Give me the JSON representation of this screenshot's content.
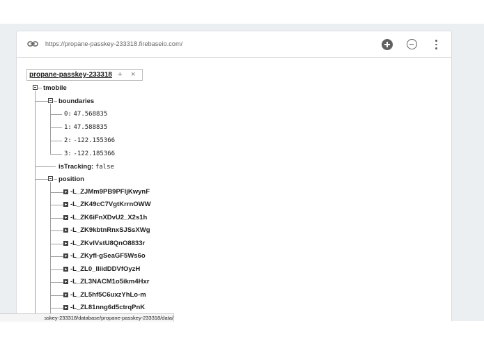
{
  "urlbar": {
    "url": "https://propane-passkey-233318.firebaseio.com/",
    "icons": {
      "link": "link-icon",
      "add": "add-circle-icon",
      "remove": "remove-circle-icon",
      "more": "more-vert-icon"
    }
  },
  "root": {
    "name": "propane-passkey-233318",
    "add_symbol": "+",
    "close_symbol": "×"
  },
  "tree": {
    "tmobile": {
      "label": "tmobile",
      "boundaries": {
        "label": "boundaries",
        "items": [
          {
            "key": "0:",
            "value": "47.568835"
          },
          {
            "key": "1:",
            "value": "47.588835"
          },
          {
            "key": "2:",
            "value": "-122.155366"
          },
          {
            "key": "3:",
            "value": "-122.185366"
          }
        ]
      },
      "isTracking": {
        "key": "isTracking:",
        "value": "false"
      },
      "position": {
        "label": "position",
        "items": [
          "-L_ZJMm9PB9PFljKwynF",
          "-L_ZK49cC7VgtKrrnOWW",
          "-L_ZK6iFnXDvU2_X2s1h",
          "-L_ZK9kbtnRnxSJSsXWg",
          "-L_ZKvlVstU8QnO8833r",
          "-L_ZKyfl-gSeaGF5Ws6o",
          "-L_ZL0_lliidDDVfOyzH",
          "-L_ZL3NACM1o5ikm4Hxr",
          "-L_ZL5hf5C6uxzYhLo-m",
          "-L_ZL81nng6d5ctrqPnK"
        ]
      }
    }
  },
  "status_bar": {
    "text": "sskey-233318/database/propane-passkey-233318/data/"
  },
  "colors": {
    "background_band": "#eceff1",
    "card": "#ffffff",
    "icon": "#616161",
    "tree_line": "#9e9e9e"
  }
}
